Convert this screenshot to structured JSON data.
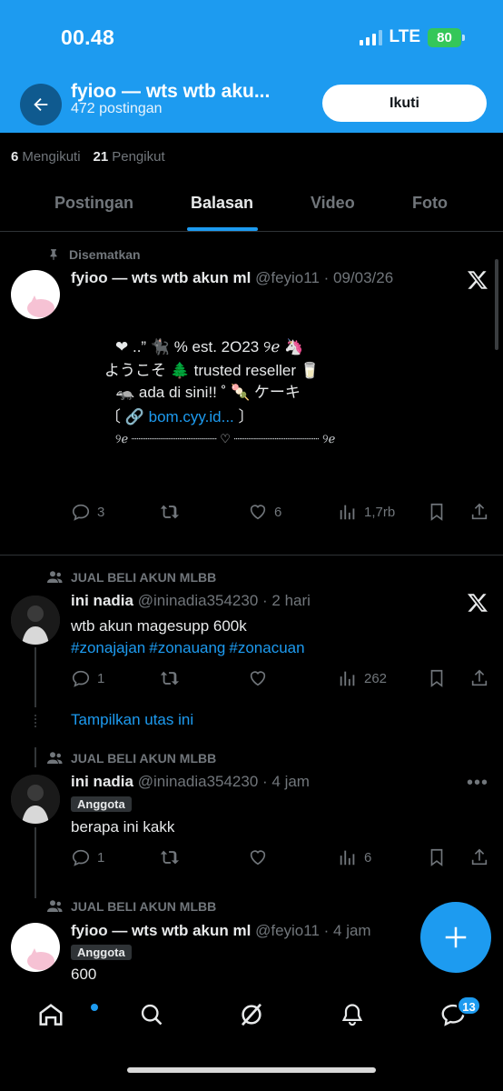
{
  "status_bar": {
    "time": "00.48",
    "network": "LTE",
    "battery": "80"
  },
  "header": {
    "title": "fyioo — wts wtb aku...",
    "posts_count": "472 postingan",
    "follow_label": "Ikuti"
  },
  "counts": {
    "following_num": "6",
    "following_label": "Mengikuti",
    "followers_num": "21",
    "followers_label": "Pengikut"
  },
  "tabs": [
    {
      "label": "Postingan"
    },
    {
      "label": "Balasan"
    },
    {
      "label": "Video"
    },
    {
      "label": "Foto"
    }
  ],
  "pinned_post": {
    "pinned_label": "Disematkan",
    "name": "fyioo — wts wtb akun ml",
    "handle_date": "@feyio11 · 09/03/26",
    "lines": [
      "❤︎ ..” 🐈‍⬛  %  est. 2O23   ୨ℯ  🦄",
      "ようこそ 🌲  trusted reseller 🥛",
      "🦡  ada di sini!! ˚ 🍡   ケーキ"
    ],
    "link_prefix": "〔 🔗 ",
    "link_text": "bom.cyy.id...",
    "link_suffix": " 〕",
    "divider_line": "୨ℯ ┈┈┈┈┈┈┈┈┈┈┈┈ ♡ ┈┈┈┈┈┈┈┈┈┈┈┈ ୨ℯ",
    "replies": "3",
    "likes": "6",
    "views": "1,7rb"
  },
  "post2": {
    "group": "JUAL BELI AKUN MLBB",
    "name": "ini nadia",
    "handle_date": "@ininadia354230 · 2 hari",
    "text": "wtb akun magesupp 600k",
    "hashtags": [
      "#zonajajan",
      "#zonauang",
      "#zonacuan"
    ],
    "replies": "1",
    "views": "262",
    "show_thread": "Tampilkan utas ini"
  },
  "post3": {
    "group": "JUAL BELI AKUN MLBB",
    "name": "ini nadia",
    "handle_date": "@ininadia354230 · 4 jam",
    "badge": "Anggota",
    "text": "berapa ini kakk",
    "replies": "1",
    "views": "6"
  },
  "post4": {
    "group": "JUAL BELI AKUN MLBB",
    "name": "fyioo — wts wtb akun ml",
    "handle_date": "@feyio11 · 4 jam",
    "badge": "Anggota",
    "text": "600"
  },
  "nav": {
    "messages_badge": "13"
  }
}
